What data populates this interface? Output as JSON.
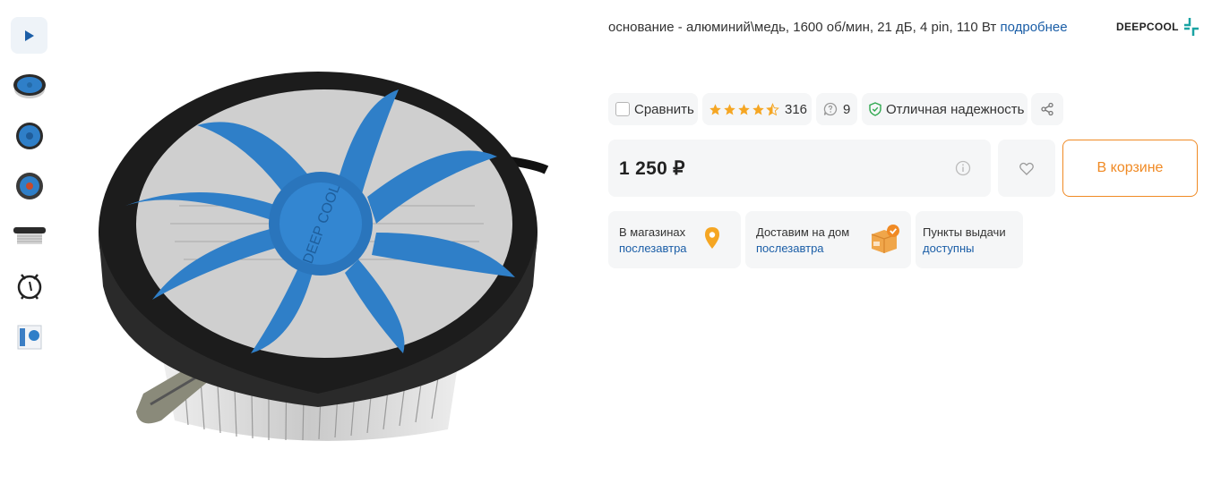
{
  "gallery": {
    "video_icon": "play-icon",
    "thumbnails": [
      "cooler-angle-view",
      "cooler-top-view",
      "cooler-top-view-2",
      "cooler-side-view",
      "mounting-bracket",
      "retail-box"
    ]
  },
  "product": {
    "specs_text": "основание - алюминий\\медь, 1600 об/мин, 21 дБ, 4 pin, 110 Вт",
    "more_link": "подробнее",
    "brand": "DEEPCOOL"
  },
  "actions": {
    "compare_label": "Сравнить",
    "rating_value": 4.5,
    "rating_count": "316",
    "questions_count": "9",
    "reliability_label": "Отличная надежность"
  },
  "purchase": {
    "price": "1 250 ₽",
    "cart_button": "В корзине"
  },
  "availability": [
    {
      "title": "В магазинах",
      "status": "послезавтра",
      "icon": "map-pin-icon"
    },
    {
      "title": "Доставим на дом",
      "status": "послезавтра",
      "icon": "delivery-box-icon"
    },
    {
      "title": "Пункты выдачи",
      "status": "доступны",
      "icon": ""
    }
  ],
  "colors": {
    "accent_orange": "#f08a24",
    "link_blue": "#1b5ea7",
    "star_orange": "#f5a623",
    "reliable_green": "#2fa84f",
    "chip_bg": "#f5f6f7",
    "fan_blue": "#2f7fc8"
  }
}
